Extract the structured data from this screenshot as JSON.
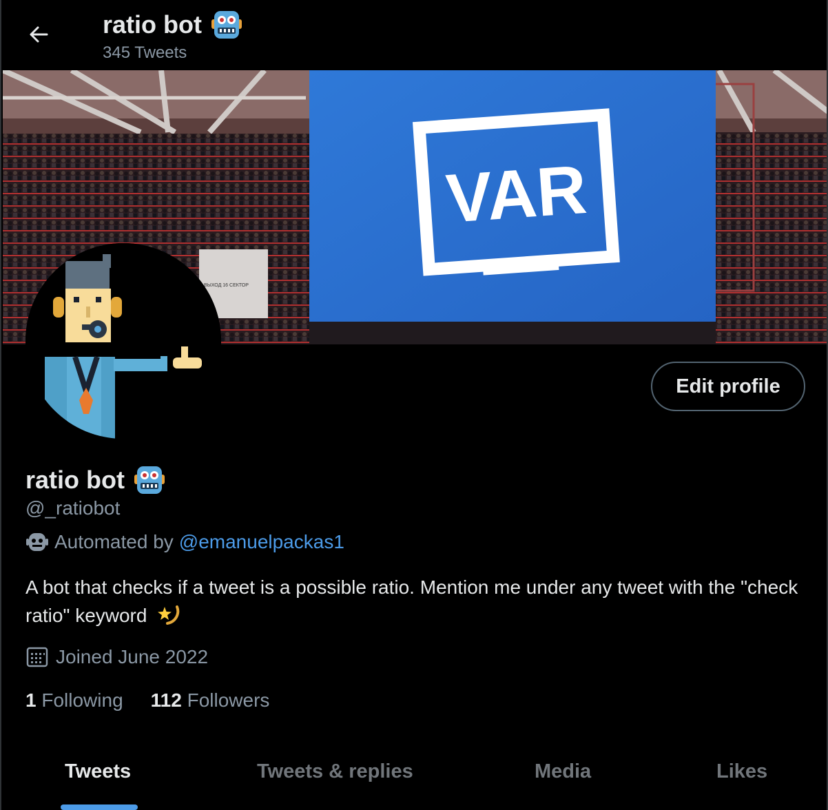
{
  "header": {
    "title": "ratio bot",
    "tweet_count": "345 Tweets"
  },
  "banner": {
    "screen_text": "VAR",
    "sign_text": "ВЫХОД 16 СЕКТОР"
  },
  "profile": {
    "name": "ratio bot",
    "handle": "@_ratiobot",
    "automated_prefix": "Automated by",
    "automated_link": "@emanuelpackas1",
    "bio": "A bot that checks if a tweet is a possible ratio. Mention me under any tweet with the \"check ratio\" keyword",
    "joined": "Joined June 2022",
    "following_count": "1",
    "following_label": "Following",
    "followers_count": "112",
    "followers_label": "Followers",
    "edit_button": "Edit profile"
  },
  "tabs": [
    {
      "label": "Tweets",
      "active": true
    },
    {
      "label": "Tweets & replies",
      "active": false
    },
    {
      "label": "Media",
      "active": false
    },
    {
      "label": "Likes",
      "active": false
    }
  ],
  "colors": {
    "accent": "#4c9be8",
    "background": "#000000",
    "secondary_text": "#8b98a5"
  },
  "icons": [
    "back-arrow-icon",
    "robot-emoji-icon",
    "bot-face-icon",
    "calendar-icon",
    "shooting-star-emoji-icon"
  ]
}
